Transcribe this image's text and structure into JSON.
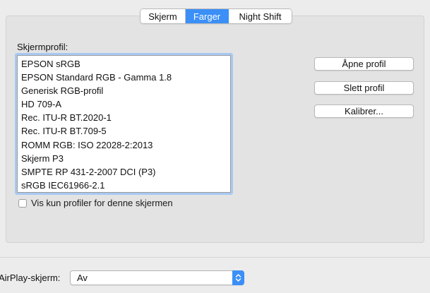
{
  "tabs": [
    {
      "label": "Skjerm",
      "selected": false
    },
    {
      "label": "Farger",
      "selected": true
    },
    {
      "label": "Night Shift",
      "selected": false
    }
  ],
  "profile_section": {
    "label": "Skjermprofil:",
    "items": [
      "EPSON  sRGB",
      "EPSON  Standard RGB - Gamma 1.8",
      "Generisk RGB-profil",
      "HD 709-A",
      "Rec. ITU-R BT.2020-1",
      "Rec. ITU-R BT.709-5",
      "ROMM RGB: ISO 22028-2:2013",
      "Skjerm P3",
      "SMPTE RP 431-2-2007 DCI (P3)",
      "sRGB IEC61966-2.1"
    ]
  },
  "buttons": {
    "open_profile": "Åpne profil",
    "delete_profile": "Slett profil",
    "calibrate": "Kalibrer..."
  },
  "checkbox": {
    "label": "Vis kun profiler for denne skjermen",
    "checked": false
  },
  "airplay": {
    "label": "AirPlay-skjerm:",
    "value": "Av"
  },
  "colors": {
    "accent": "#3b8ff7",
    "window_background": "#ececec"
  },
  "icons": {
    "popup_arrows": "chevron-up-down-icon"
  }
}
